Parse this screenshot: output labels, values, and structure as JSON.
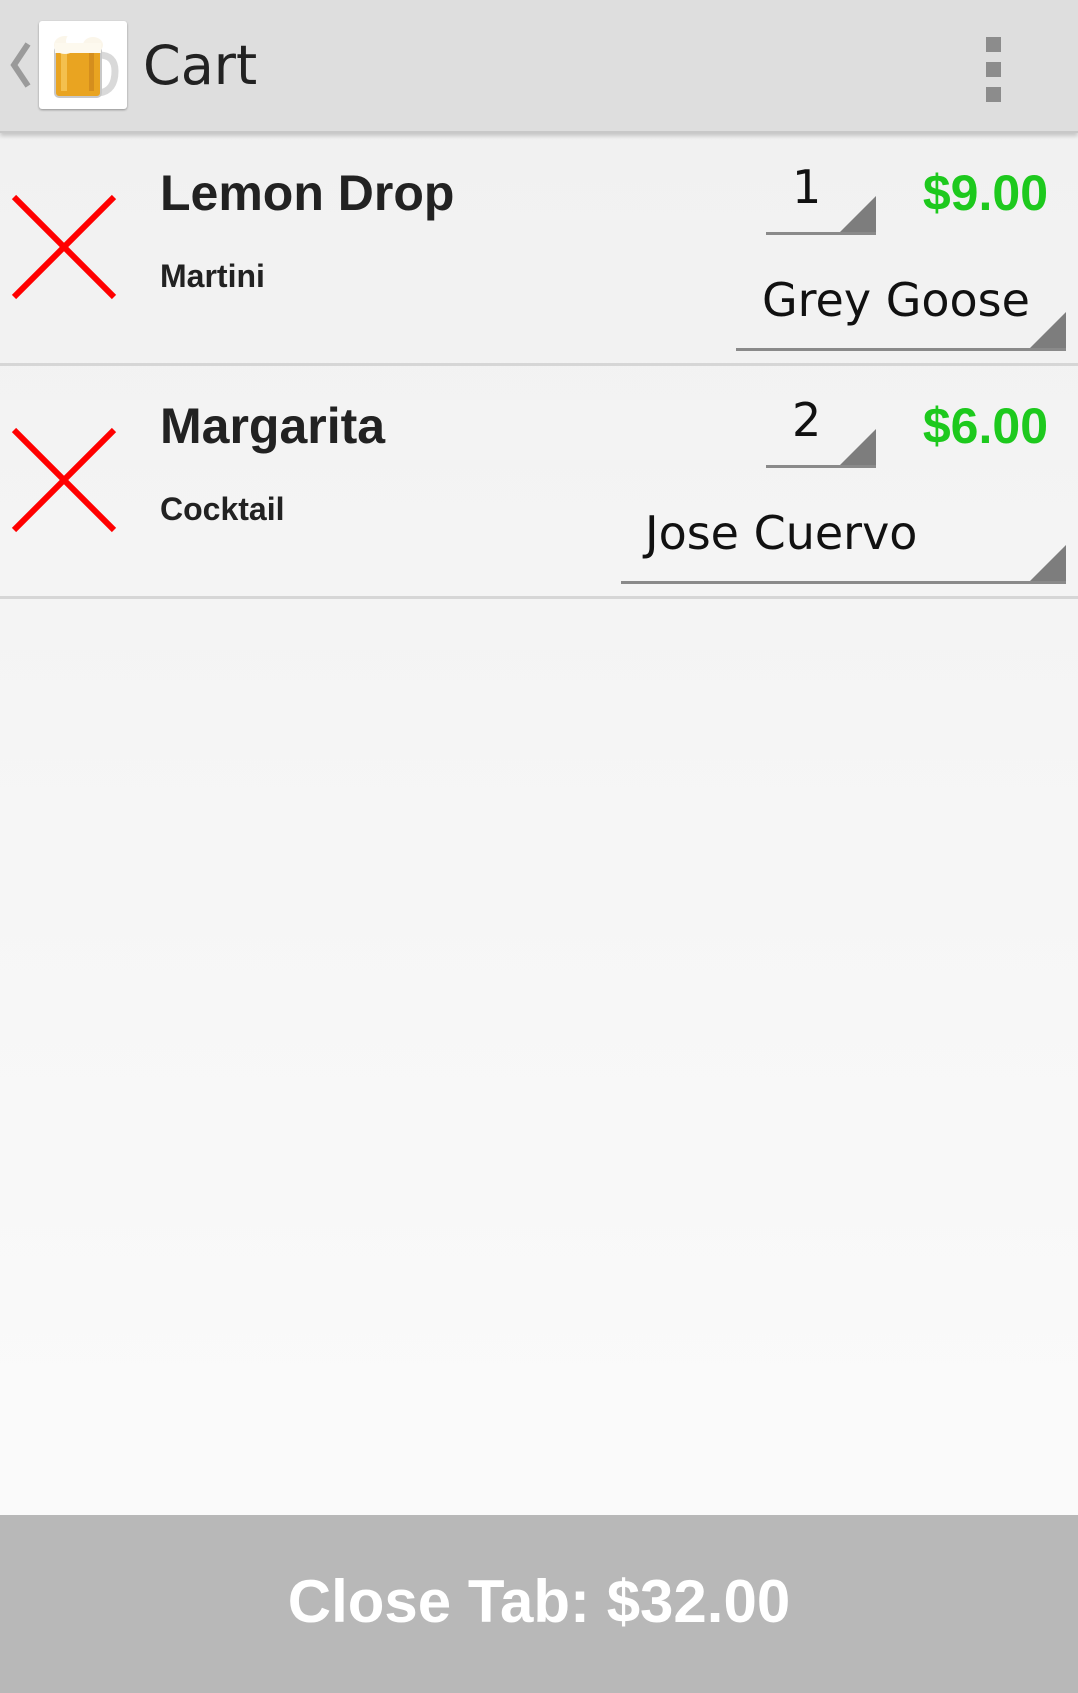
{
  "action_bar": {
    "title": "Cart",
    "app_icon": "beer-mug-icon",
    "back_icon": "chevron-left-icon",
    "overflow_icon": "overflow-menu-icon"
  },
  "cart": {
    "items": [
      {
        "name": "Lemon Drop",
        "category": "Martini",
        "quantity": "1",
        "price": "$9.00",
        "liquor": "Grey Goose"
      },
      {
        "name": "Margarita",
        "category": "Cocktail",
        "quantity": "2",
        "price": "$6.00",
        "liquor": "Jose Cuervo"
      }
    ],
    "remove_icon": "red-x-icon"
  },
  "footer": {
    "close_tab_label": "Close Tab: $32.00"
  },
  "colors": {
    "price": "#1dc91d",
    "remove_x": "#ff0000",
    "action_bar": "#dedede",
    "close_tab_bg": "#b8b8b8"
  }
}
